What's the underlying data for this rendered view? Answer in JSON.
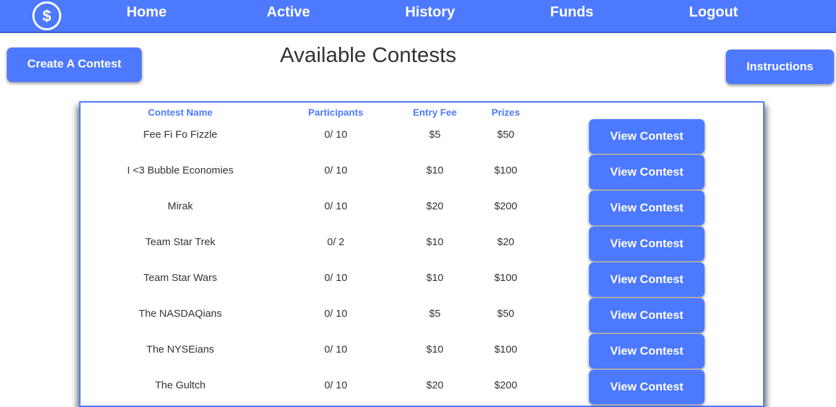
{
  "nav": {
    "logo_symbol": "$",
    "items": [
      "Home",
      "Active",
      "History",
      "Funds",
      "Logout"
    ]
  },
  "create_button": "Create A Contest",
  "page_title": "Available Contests",
  "instructions_button": "Instructions",
  "table": {
    "headers": [
      "Contest Name",
      "Participants",
      "Entry Fee",
      "Prizes"
    ],
    "action_label": "View Contest",
    "rows": [
      {
        "name": "Fee Fi Fo Fizzle",
        "participants": "0/ 10",
        "fee": "$5",
        "prize": "$50"
      },
      {
        "name": "I <3 Bubble Economies",
        "participants": "0/ 10",
        "fee": "$10",
        "prize": "$100"
      },
      {
        "name": "Mirak",
        "participants": "0/ 10",
        "fee": "$20",
        "prize": "$200"
      },
      {
        "name": "Team Star Trek",
        "participants": "0/ 2",
        "fee": "$10",
        "prize": "$20"
      },
      {
        "name": "Team Star Wars",
        "participants": "0/ 10",
        "fee": "$10",
        "prize": "$100"
      },
      {
        "name": "The NASDAQians",
        "participants": "0/ 10",
        "fee": "$5",
        "prize": "$50"
      },
      {
        "name": "The NYSEians",
        "participants": "0/ 10",
        "fee": "$10",
        "prize": "$100"
      },
      {
        "name": "The Gultch",
        "participants": "0/ 10",
        "fee": "$20",
        "prize": "$200"
      }
    ]
  },
  "colors": {
    "accent": "#4d79ff",
    "text": "#333333"
  }
}
